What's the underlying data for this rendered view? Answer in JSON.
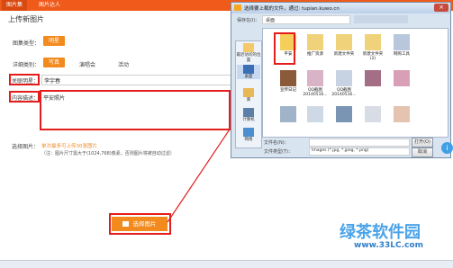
{
  "tabs": [
    {
      "label": "图片集",
      "active": true
    },
    {
      "label": "图片达人",
      "active": false
    }
  ],
  "page_title": "上传新图片",
  "form": {
    "type_label": "图集类型：",
    "type_value": "明星",
    "category_label": "详细类别：",
    "category_options": [
      "写真",
      "演唱会",
      "活动"
    ],
    "related_star_label": "关联明星：",
    "related_star_value": "李宇春",
    "description_label": "内容描述：",
    "description_value": "平安照片",
    "select_label": "选择图片：",
    "hint_primary": "单次最多可上传30张图片",
    "hint_secondary": "（注：图片尺寸需大于(1024,768)像素，否则图片将被自动过滤）",
    "select_button": "选择图片"
  },
  "dialog": {
    "title": "选择要上载的文件，通过: tupian.kuwo.cn",
    "look_in_label": "保存在(I)：",
    "look_in_value": "桌面",
    "sidebar": [
      {
        "label": "最近访问的位置",
        "icon": "recent-icon"
      },
      {
        "label": "桌面",
        "icon": "desktop-icon"
      },
      {
        "label": "库",
        "icon": "library-icon"
      },
      {
        "label": "计算机",
        "icon": "computer-icon"
      },
      {
        "label": "网络",
        "icon": "network-icon"
      }
    ],
    "files": [
      {
        "name": "平安",
        "kind": "folder",
        "selected": true
      },
      {
        "name": "推广资源",
        "kind": "folder",
        "selected": false
      },
      {
        "name": "新建文件夹",
        "kind": "folder",
        "selected": false
      },
      {
        "name": "新建文件夹(2)",
        "kind": "folder",
        "selected": false
      },
      {
        "name": "网购工具",
        "kind": "folder",
        "selected": false
      },
      {
        "name": "宣传日记",
        "kind": "image",
        "selected": false
      },
      {
        "name": "QQ截图20140516...",
        "kind": "image",
        "selected": false
      },
      {
        "name": "QQ截图20140516...",
        "kind": "image",
        "selected": false
      },
      {
        "name": "",
        "kind": "image",
        "selected": false
      },
      {
        "name": "",
        "kind": "image",
        "selected": false
      },
      {
        "name": "",
        "kind": "image",
        "selected": false
      },
      {
        "name": "",
        "kind": "image",
        "selected": false
      },
      {
        "name": "",
        "kind": "image",
        "selected": false
      },
      {
        "name": "",
        "kind": "image",
        "selected": false
      },
      {
        "name": "",
        "kind": "image",
        "selected": false
      }
    ],
    "filename_label": "文件名(N)：",
    "filename_value": "",
    "filetype_label": "文件类型(T)：",
    "filetype_value": "Images (*.jpg, *.jpeg, *.png)",
    "open_button": "打开(O)",
    "cancel_button": "取消"
  },
  "watermark": {
    "text": "绿茶软件园",
    "url": "www.33LC.com"
  },
  "colors": {
    "accent": "#f28a1e",
    "highlight": "#e51c1c",
    "topbar": "#f05a1a"
  }
}
